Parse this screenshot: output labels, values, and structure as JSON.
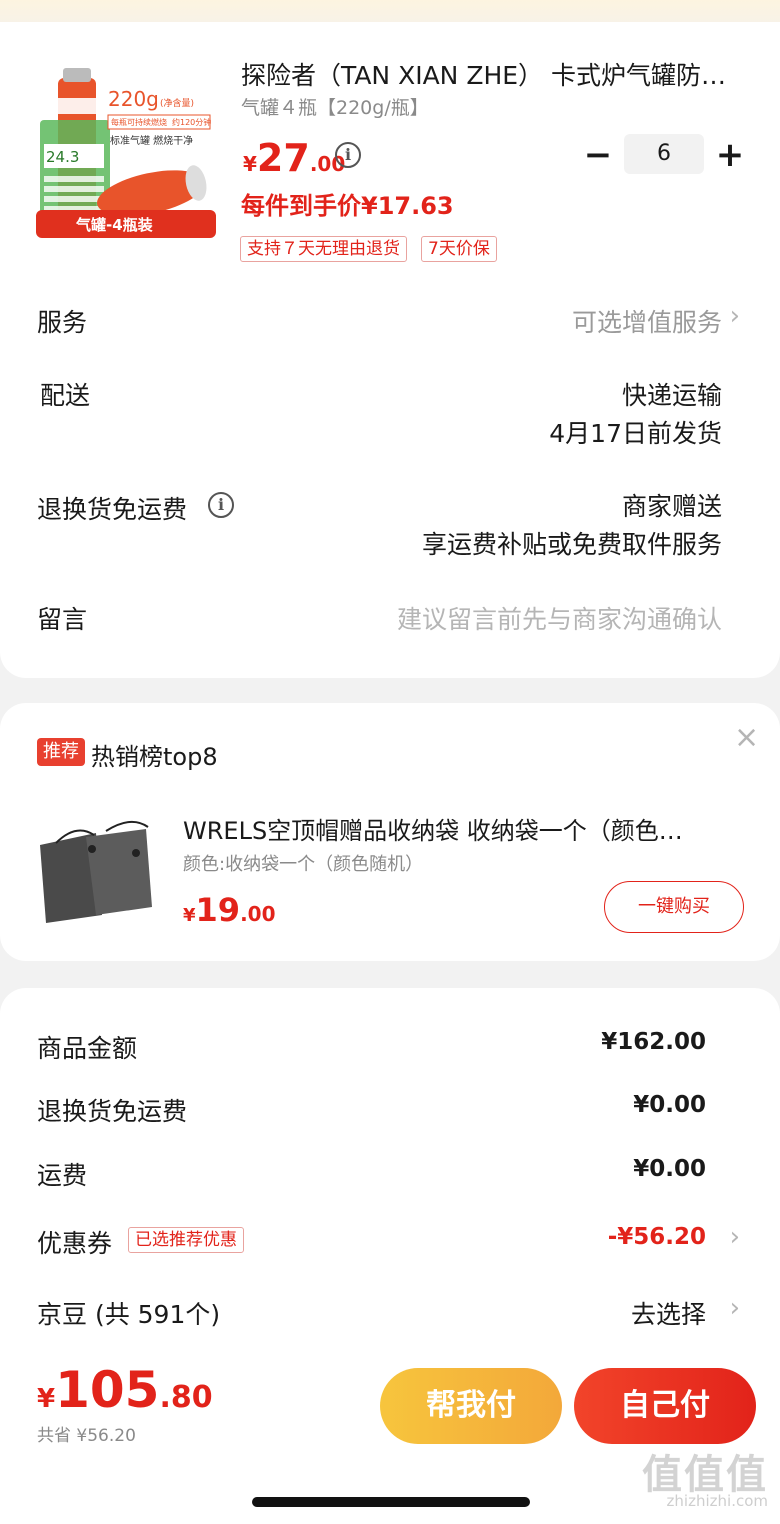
{
  "product": {
    "title": "探险者（TAN XIAN ZHE） 卡式炉气罐防…",
    "spec": "气罐４瓶【220g/瓶】",
    "price_currency": "¥",
    "price_int": "27",
    "price_dec": ".00",
    "quantity": "6",
    "minus": "−",
    "plus": "+",
    "unit_price_label": "每件到手价¥17.63",
    "tags": [
      "支持７天无理由退货",
      "7天价保"
    ],
    "image_texts": {
      "weight": "220g",
      "weight_note": "(净含量)",
      "line1": "每瓶可持续燃烧",
      "line2": "约120分钟",
      "line3": "标准气罐 燃烧干净",
      "price_badge": "24.3",
      "banner": "气罐-4瓶装"
    }
  },
  "rows": {
    "service": {
      "label": "服务",
      "value": "可选增值服务"
    },
    "delivery": {
      "label": "配送",
      "value": "快递运输",
      "value2": "4月17日前发货"
    },
    "return_shipping": {
      "label": "退换货免运费",
      "value": "商家赠送",
      "value2": "享运费补贴或免费取件服务"
    },
    "message": {
      "label": "留言",
      "placeholder": "建议留言前先与商家沟通确认"
    }
  },
  "recommend": {
    "badge": "推荐",
    "title": "热销榜top8",
    "item_title": "WRELS空顶帽赠品收纳袋 收纳袋一个（颜色…",
    "item_spec": "颜色:收纳袋一个（颜色随机）",
    "price_currency": "¥",
    "price_int": "19",
    "price_dec": ".00",
    "buy_label": "一键购买",
    "close": "×"
  },
  "summary": {
    "goods_amount": {
      "label": "商品金额",
      "value": "¥162.00"
    },
    "return_fee": {
      "label": "退换货免运费",
      "value": "¥0.00"
    },
    "shipping": {
      "label": "运费",
      "value": "¥0.00"
    },
    "coupon": {
      "label": "优惠券",
      "tag": "已选推荐优惠",
      "value": "-¥56.20"
    },
    "jingdou": {
      "label": "京豆 (共 591个)",
      "value": "去选择"
    }
  },
  "bottom": {
    "currency": "¥",
    "total_int": "105",
    "total_dec": ".80",
    "saved": "共省 ¥56.20",
    "help_pay": "帮我付",
    "self_pay": "自己付"
  },
  "watermark": {
    "main": "值值值",
    "sub": "zhizhizhi.com"
  },
  "icons": {
    "chevron": "chevron-right-icon",
    "info": "info-icon",
    "close": "close-icon"
  },
  "colors": {
    "accent_red": "#e2231a",
    "help_yellow": "#f5b53b"
  }
}
